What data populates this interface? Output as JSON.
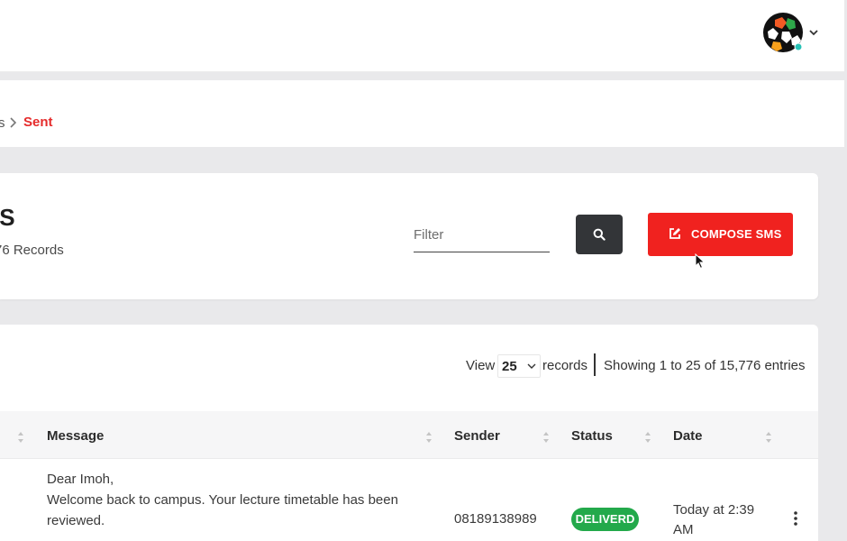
{
  "breadcrumb": {
    "prev": "s",
    "current": "Sent"
  },
  "page": {
    "title": "IS",
    "record_count": "76 Records"
  },
  "filter": {
    "placeholder": "Filter",
    "value": ""
  },
  "compose": {
    "label": "COMPOSE SMS"
  },
  "pagination": {
    "view_label": "View",
    "page_size": "25",
    "records_label": "records",
    "showing": "Showing 1 to 25 of 15,776 entries"
  },
  "table": {
    "columns": [
      "Message",
      "Sender",
      "Status",
      "Date"
    ],
    "rows": [
      {
        "message_line1": "Dear Imoh,",
        "message_line2": "Welcome back to campus. Your lecture timetable has been",
        "message_line3": "reviewed.",
        "sender": "08189138989",
        "status": "DELIVERD",
        "date_line1": "Today at 2:39",
        "date_line2": "AM"
      }
    ]
  },
  "colors": {
    "accent": "#f0221f",
    "breadcrumb_active": "#e52b2b",
    "status_delivered": "#23a94b",
    "search_button": "#333538"
  },
  "icons": {
    "avatar": "user-avatar-icon",
    "menu": "chevron-down-icon",
    "search": "search-icon",
    "compose": "edit-icon",
    "row_actions": "more-vertical-icon"
  }
}
